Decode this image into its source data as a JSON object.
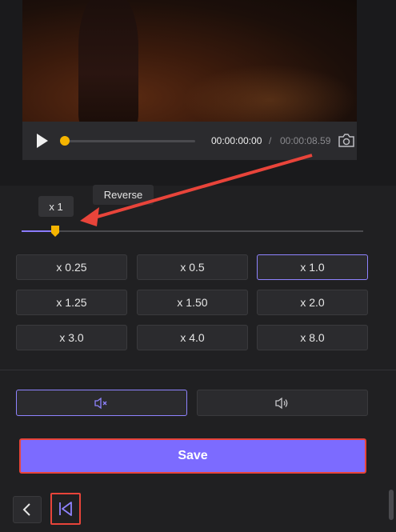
{
  "player": {
    "time_current": "00:00:00:00",
    "time_separator": "/",
    "time_total": "00:00:08.59",
    "progress": 0
  },
  "speed": {
    "reverse_tooltip": "Reverse",
    "current_label": "x 1",
    "slider_value": 0.1,
    "presets": [
      {
        "label": "x 0.25",
        "active": false
      },
      {
        "label": "x 0.5",
        "active": false
      },
      {
        "label": "x 1.0",
        "active": true
      },
      {
        "label": "x 1.25",
        "active": false
      },
      {
        "label": "x 1.50",
        "active": false
      },
      {
        "label": "x 2.0",
        "active": false
      },
      {
        "label": "x 3.0",
        "active": false
      },
      {
        "label": "x 4.0",
        "active": false
      },
      {
        "label": "x 8.0",
        "active": false
      }
    ]
  },
  "audio": {
    "mute_icon": "speaker-muted-icon",
    "sound_icon": "speaker-on-icon",
    "mute_active": true
  },
  "actions": {
    "save_label": "Save",
    "back_icon": "chevron-left-icon",
    "collapse_icon": "skip-to-start-icon"
  },
  "colors": {
    "accent": "#7c6bff",
    "knob": "#f5b400",
    "highlight_border": "#e8443a",
    "annotation_arrow": "#e8443a"
  }
}
